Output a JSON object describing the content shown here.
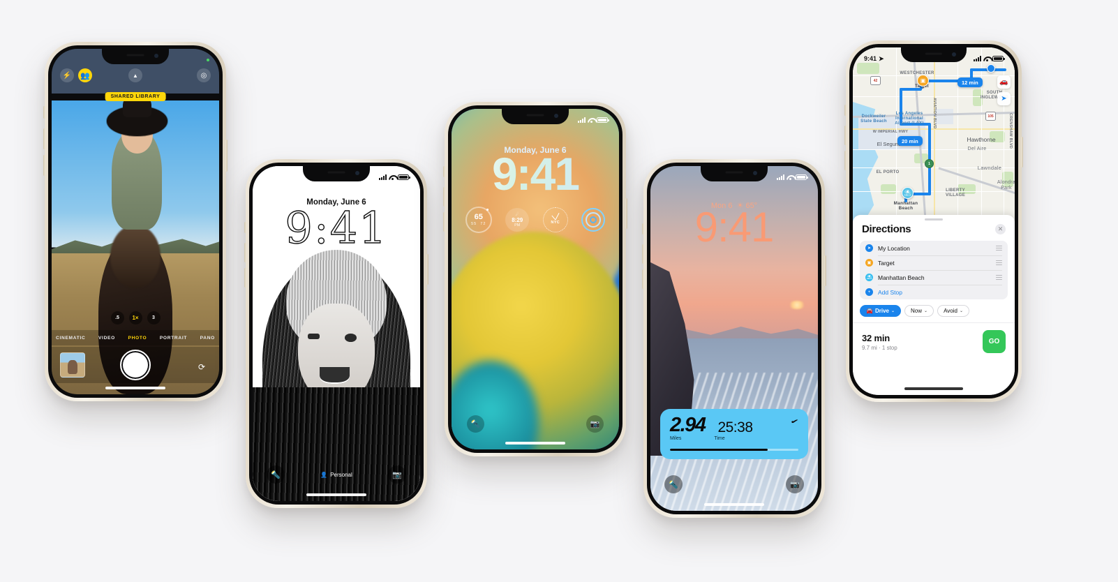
{
  "page": {
    "background_color": "#f5f5f7",
    "frame_color": "starlight"
  },
  "phone1_camera": {
    "name": "camera-app",
    "controls": {
      "flash": "⚡",
      "shared_library": "shared-library-icon",
      "chevron": "⌃",
      "live_photo": "◎"
    },
    "badge": "SHARED LIBRARY",
    "zoom_levels": [
      ".5",
      "1×",
      "3"
    ],
    "zoom_active": "1×",
    "modes": [
      "CINEMATIC",
      "VIDEO",
      "PHOTO",
      "PORTRAIT",
      "PANO"
    ],
    "mode_active": "PHOTO",
    "shutter_label": "shutter-button",
    "flip_label": "flip-camera-button",
    "thumbnail_label": "photo-thumbnail"
  },
  "phone2_lock_bw": {
    "status": {
      "time": "",
      "signal": "signal-icon",
      "wifi": "wifi-icon",
      "battery": "battery-icon"
    },
    "date": "Monday, June 6",
    "time": "9:41",
    "focus": "Personal",
    "flashlight": "flashlight-icon",
    "camera": "camera-icon"
  },
  "phone3_lock_gradient": {
    "date": "Monday, June 6",
    "time": "9:41",
    "widgets": [
      {
        "type": "weather",
        "value": "65",
        "low": "55",
        "high": "72",
        "name": "weather-widget"
      },
      {
        "type": "sunset",
        "time": "8:29",
        "meridiem": "PM",
        "name": "sunset-widget"
      },
      {
        "type": "world-clock",
        "label": "NYC",
        "name": "world-clock-widget"
      },
      {
        "type": "activity-rings",
        "name": "activity-rings-widget"
      }
    ],
    "flashlight": "flashlight-icon",
    "camera": "camera-icon"
  },
  "phone4_lock_nike": {
    "date": "Mon 6",
    "weather_icon": "☀",
    "temperature": "65°",
    "time": "9:41",
    "nike_widget": {
      "brand": "nike-swoosh-icon",
      "distance": "2.94",
      "distance_label": "Miles",
      "duration": "25:38",
      "duration_label": "Time",
      "progress_percent": 76,
      "accent_color": "#5ac8f5"
    },
    "flashlight": "flashlight-icon",
    "camera": "camera-icon"
  },
  "phone5_maps": {
    "status": {
      "time": "9:41",
      "location_arrow": "location-arrow-icon"
    },
    "map": {
      "eta_pills": [
        {
          "label": "12 min"
        },
        {
          "label": "20 min"
        }
      ],
      "pins": [
        {
          "name": "target-pin",
          "label": "Target"
        },
        {
          "name": "manhattan-beach-pin",
          "label": "Manhattan\nBeach"
        },
        {
          "name": "my-location-dot",
          "label": ""
        }
      ],
      "labels": [
        "WESTCHESTER",
        "SOUTH\nINGLEWOOD",
        "Hawthorne",
        "Del Aire",
        "Lawndale",
        "Alondra\nPark",
        "El Segundo",
        "EL PORTO",
        "LIBERTY\nVILLAGE",
        "Dockweiler\nState Beach",
        "Los Angeles\nInternational\nAirport (LAX)",
        "W IMPERIAL HWY",
        "AVIATION BLVD",
        "CRENSHAW BLVD",
        "Manhattan\nBeach"
      ],
      "route_shields": [
        "42",
        "1",
        "105"
      ],
      "controls": [
        "traffic-icon",
        "locate-icon"
      ]
    },
    "sheet": {
      "title": "Directions",
      "close": "close-icon",
      "stops": [
        {
          "label": "My Location",
          "icon": "current-location-icon"
        },
        {
          "label": "Target",
          "icon": "shopping-bag-icon"
        },
        {
          "label": "Manhattan Beach",
          "icon": "beach-icon"
        }
      ],
      "add_stop": "Add Stop",
      "chips": [
        {
          "label": "Drive",
          "icon": "car-icon",
          "active": true
        },
        {
          "label": "Now",
          "active": false
        },
        {
          "label": "Avoid",
          "active": false
        }
      ],
      "route": {
        "time": "32 min",
        "detail": "9.7 mi · 1 stop",
        "go_label": "GO",
        "go_color": "#34c759"
      }
    }
  }
}
